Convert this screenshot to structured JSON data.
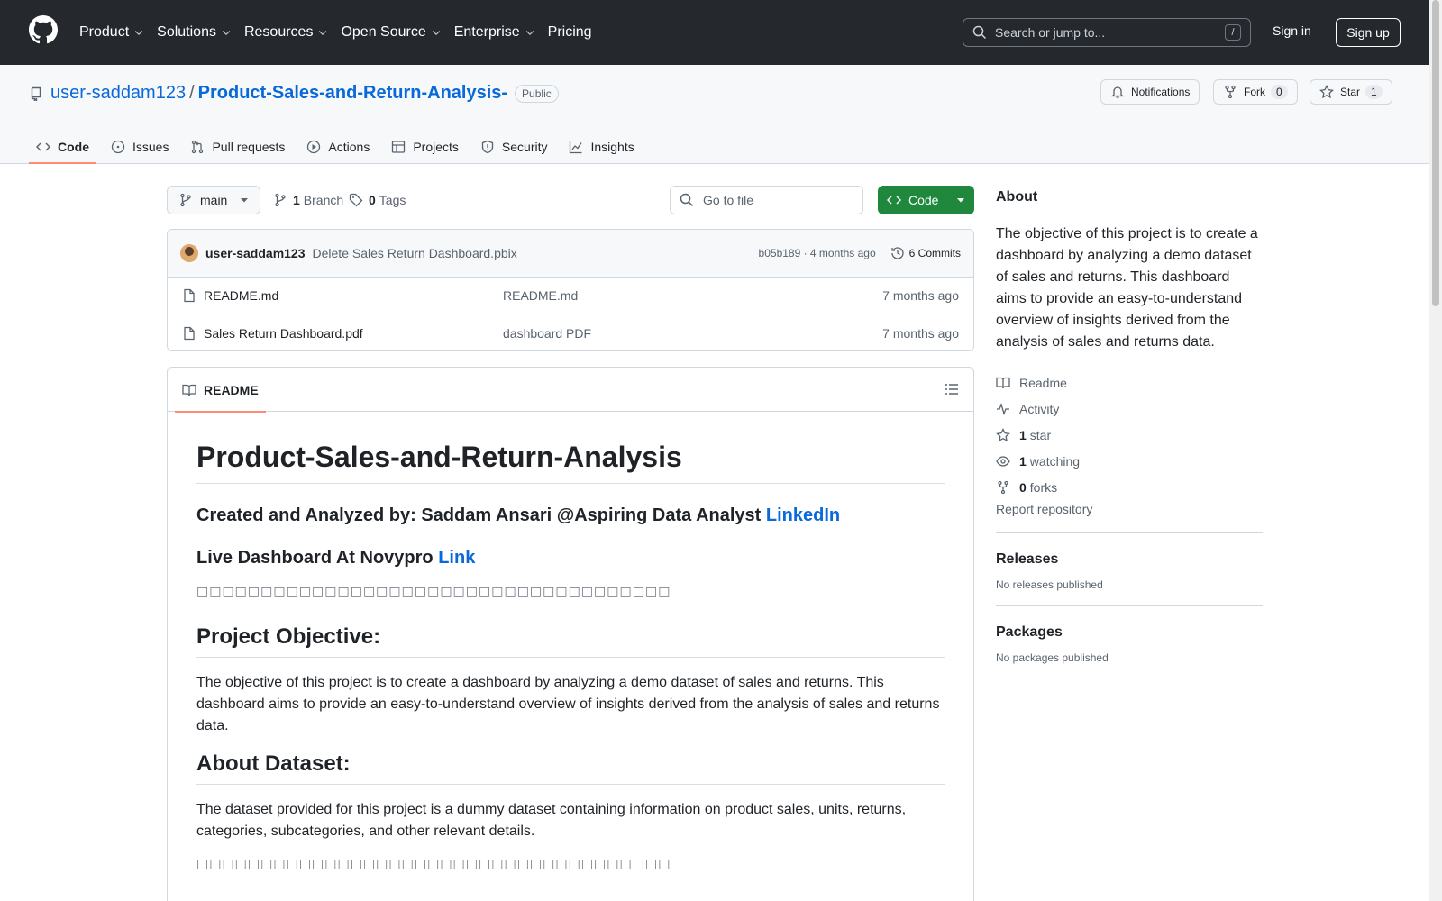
{
  "header": {
    "nav": [
      {
        "label": "Product",
        "dropdown": true
      },
      {
        "label": "Solutions",
        "dropdown": true
      },
      {
        "label": "Resources",
        "dropdown": true
      },
      {
        "label": "Open Source",
        "dropdown": true
      },
      {
        "label": "Enterprise",
        "dropdown": true
      },
      {
        "label": "Pricing",
        "dropdown": false
      }
    ],
    "search_placeholder": "Search or jump to...",
    "search_shortcut": "/",
    "sign_in": "Sign in",
    "sign_up": "Sign up"
  },
  "repo": {
    "owner": "user-saddam123",
    "separator": "/",
    "name": "Product-Sales-and-Return-Analysis-",
    "visibility": "Public",
    "notifications_label": "Notifications",
    "fork_label": "Fork",
    "fork_count": "0",
    "star_label": "Star",
    "star_count": "1"
  },
  "tabs": [
    {
      "label": "Code",
      "icon": "code-icon",
      "active": true
    },
    {
      "label": "Issues",
      "icon": "issue-icon",
      "active": false
    },
    {
      "label": "Pull requests",
      "icon": "pull-request-icon",
      "active": false
    },
    {
      "label": "Actions",
      "icon": "play-icon",
      "active": false
    },
    {
      "label": "Projects",
      "icon": "table-icon",
      "active": false
    },
    {
      "label": "Security",
      "icon": "shield-icon",
      "active": false
    },
    {
      "label": "Insights",
      "icon": "graph-icon",
      "active": false
    }
  ],
  "toolbar": {
    "branch": "main",
    "branch_count": "1",
    "branch_label": "Branch",
    "tag_count": "0",
    "tag_label": "Tags",
    "goto_placeholder": "Go to file",
    "code_button": "Code"
  },
  "commit": {
    "user": "user-saddam123",
    "message": "Delete Sales Return Dashboard.pbix",
    "sha_time": "b05b189 · 4 months ago",
    "commits_label": "6 Commits"
  },
  "files": [
    {
      "name": "README.md",
      "message": "README.md",
      "time": "7 months ago"
    },
    {
      "name": "Sales Return Dashboard.pdf",
      "message": "dashboard PDF",
      "time": "7 months ago"
    }
  ],
  "readme": {
    "tab_label": "README",
    "title": "Product-Sales-and-Return-Analysis",
    "created_by": "Created and Analyzed by: Saddam Ansari @Aspiring Data Analyst ",
    "created_link": "LinkedIn",
    "live_text": "Live Dashboard At Novypro ",
    "live_link": "Link",
    "boxes": "□□□□□□□□□□□□□□□□□□□□□□□□□□□□□□□□□□□□□",
    "objective_heading": "Project Objective:",
    "objective_text": "The objective of this project is to create a dashboard by analyzing a demo dataset of sales and returns. This dashboard aims to provide an easy-to-understand overview of insights derived from the analysis of sales and returns data.",
    "dataset_heading": "About Dataset:",
    "dataset_text": "The dataset provided for this project is a dummy dataset containing information on product sales, units, returns, categories, subcategories, and other relevant details.",
    "boxes2": "□□□□□□□□□□□□□□□□□□□□□□□□□□□□□□□□□□□□□"
  },
  "sidebar": {
    "about_heading": "About",
    "description": "The objective of this project is to create a dashboard by analyzing a demo dataset of sales and returns. This dashboard aims to provide an easy-to-understand overview of insights derived from the analysis of sales and returns data.",
    "readme": "Readme",
    "activity": "Activity",
    "stars_count": "1",
    "stars_label": "star",
    "watching_count": "1",
    "watching_label": "watching",
    "forks_count": "0",
    "forks_label": "forks",
    "report": "Report repository",
    "releases_heading": "Releases",
    "releases_note": "No releases published",
    "packages_heading": "Packages",
    "packages_note": "No packages published"
  },
  "colors": {
    "header_bg": "#25292e",
    "link": "#0969da",
    "primary_button": "#1f883d",
    "active_tab_underline": "#fd8c73"
  }
}
